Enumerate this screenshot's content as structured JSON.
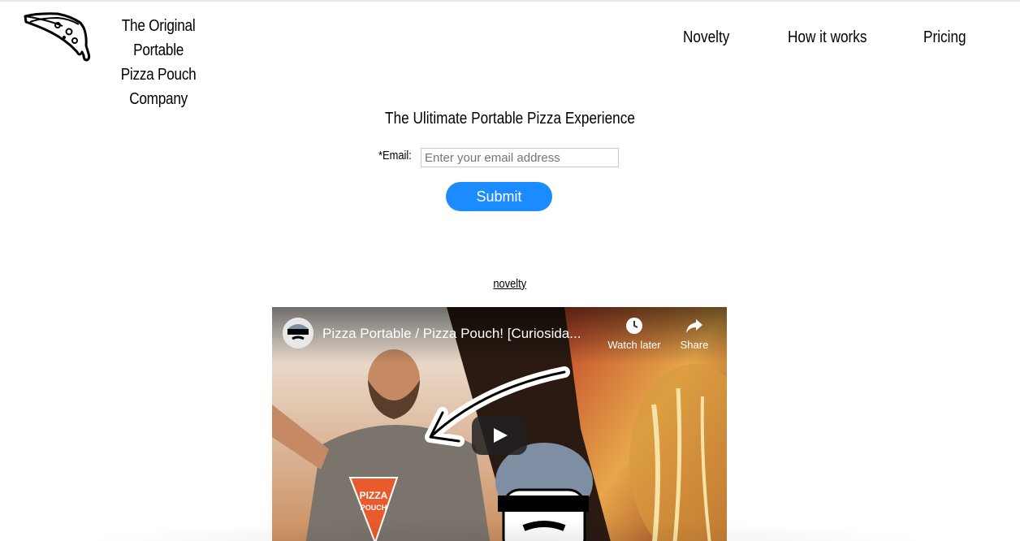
{
  "header": {
    "brand_line1": "The Original Portable",
    "brand_line2": "Pizza Pouch Company",
    "logo_icon": "pizza-slice-icon",
    "nav": [
      {
        "label": "Novelty"
      },
      {
        "label": "How it works"
      },
      {
        "label": "Pricing"
      }
    ]
  },
  "signup": {
    "headline": "The Ulitimate Portable Pizza Experience",
    "email_label": "*Email:",
    "email_placeholder": "Enter your email address",
    "email_value": "",
    "submit_label": "Submit"
  },
  "section_link": "novelty",
  "video": {
    "title": "Pizza Portable / Pizza Pouch! [Curiosida...",
    "watch_later_label": "Watch later",
    "share_label": "Share",
    "icons": [
      "clock-icon",
      "share-arrow-icon",
      "play-icon"
    ],
    "thumbnail_text_line1": "PIZZA",
    "thumbnail_text_line2": "POUCH"
  },
  "colors": {
    "submit_button": "#1a8cff",
    "text": "#000000",
    "background": "#ffffff"
  }
}
